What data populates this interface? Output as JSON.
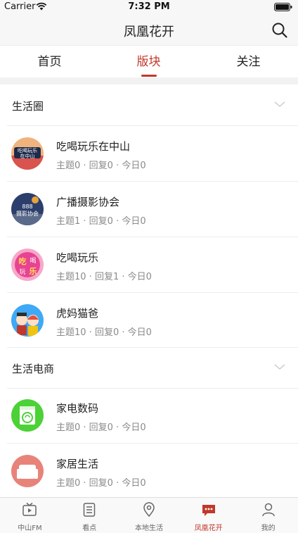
{
  "status_bar": {
    "carrier": "Carrier",
    "time": "7:32 PM"
  },
  "nav": {
    "title": "凤凰花开",
    "search_icon": "search-icon"
  },
  "tabs": [
    {
      "label": "首页",
      "active": false
    },
    {
      "label": "版块",
      "active": true
    },
    {
      "label": "关注",
      "active": false
    }
  ],
  "sections": [
    {
      "title": "生活圈",
      "forums": [
        {
          "name": "吃喝玩乐在中山",
          "stats": "主题0 · 回复0 · 今日0",
          "avatar_text": "吃喝玩乐在中山",
          "avatar_color": "#d9534f"
        },
        {
          "name": "广播摄影协会",
          "stats": "主题1 · 回复0 · 今日0",
          "avatar_text": "888摄影协会",
          "avatar_color": "#2c3e6b"
        },
        {
          "name": "吃喝玩乐",
          "stats": "主题10 · 回复1 · 今日0",
          "avatar_text": "吃喝玩乐",
          "avatar_color": "#e84393"
        },
        {
          "name": "虎妈猫爸",
          "stats": "主题10 · 回复0 · 今日0",
          "avatar_text": "",
          "avatar_color": "#3fa9f5"
        }
      ]
    },
    {
      "title": "生活电商",
      "forums": [
        {
          "name": "家电数码",
          "stats": "主题0 · 回复0 · 今日0",
          "avatar_text": "",
          "avatar_color": "#4cd137"
        },
        {
          "name": "家居生活",
          "stats": "主题0 · 回复0 · 今日0",
          "avatar_text": "",
          "avatar_color": "#e8837a"
        }
      ]
    }
  ],
  "tabbar": [
    {
      "label": "中山FM",
      "icon": "tv-icon",
      "active": false
    },
    {
      "label": "看点",
      "icon": "document-icon",
      "active": false
    },
    {
      "label": "本地生活",
      "icon": "location-pin-icon",
      "active": false
    },
    {
      "label": "凤凰花开",
      "icon": "chat-bubble-icon",
      "active": true
    },
    {
      "label": "我的",
      "icon": "person-icon",
      "active": false
    }
  ],
  "colors": {
    "accent": "#c0392b",
    "muted_text": "#8a8a8a",
    "separator": "#f2f2f2"
  }
}
